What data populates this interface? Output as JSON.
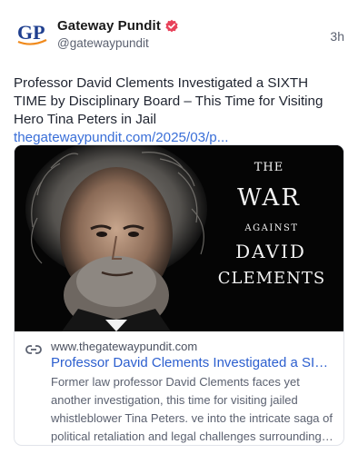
{
  "author": {
    "display_name": "Gateway Pundit",
    "handle": "@gatewaypundit",
    "avatar_text": "GP",
    "verified": true
  },
  "post": {
    "timestamp": "3h",
    "text": "Professor David Clements Investigated a SIXTH TIME by Disciplinary Board – This Time for Visiting Hero Tina Peters in Jail",
    "link_text": "thegatewaypundit.com/2025/03/p..."
  },
  "card": {
    "image_text": {
      "the": "THE",
      "war": "WAR",
      "against": "AGAINST",
      "david": "DAVID",
      "clements": "CLEMENTS"
    },
    "domain": "www.thegatewaypundit.com",
    "title": "Professor David Clements Investigated a SIXTH TIME by Disciplinary Board",
    "description": "Former law professor David Clements faces yet another investigation, this time for visiting jailed whistleblower Tina Peters. ve into the intricate saga of political retaliation and legal challenges surrounding his fight for justice."
  },
  "colors": {
    "link": "#3a6fd8",
    "card_title": "#2c5fcf",
    "verified": "#e8425a",
    "avatar_blue": "#1f3f8f",
    "avatar_orange": "#f08a1c"
  },
  "icons": {
    "verified": "verified-badge-icon",
    "link": "link-chain-icon"
  }
}
